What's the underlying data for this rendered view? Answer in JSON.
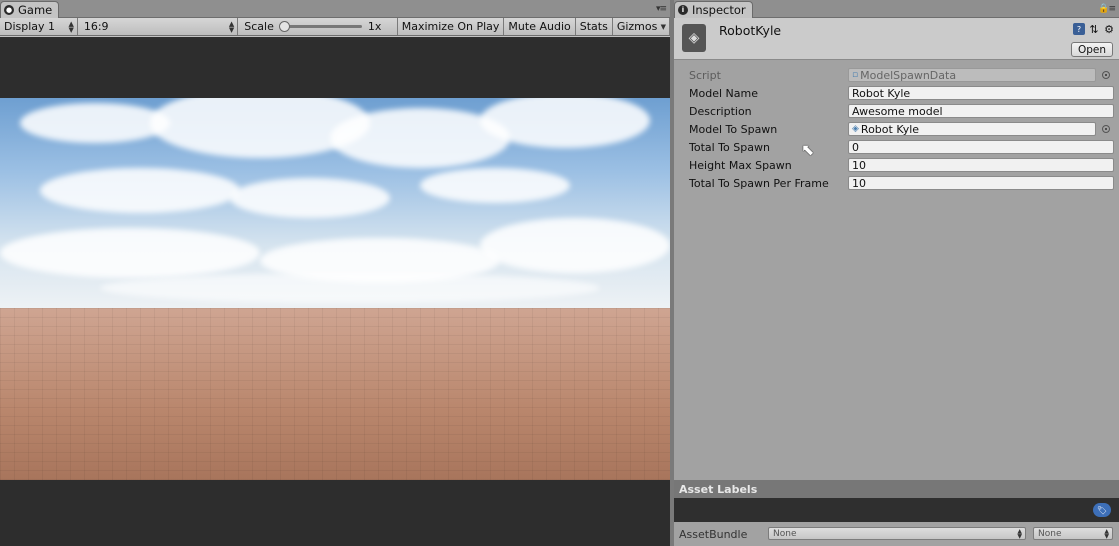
{
  "game": {
    "tab_label": "Game",
    "toolbar": {
      "display": "Display 1",
      "aspect": "16:9",
      "scale_label": "Scale",
      "scale_value": "1x",
      "maximize_on_play": "Maximize On Play",
      "mute_audio": "Mute Audio",
      "stats": "Stats",
      "gizmos": "Gizmos"
    }
  },
  "inspector": {
    "tab_label": "Inspector",
    "asset_name": "RobotKyle",
    "open_button": "Open",
    "fields": [
      {
        "label": "Script",
        "value": "ModelSpawnData"
      },
      {
        "label": "Model Name",
        "value": "Robot Kyle"
      },
      {
        "label": "Description",
        "value": "Awesome model"
      },
      {
        "label": "Model To Spawn",
        "value": "Robot Kyle"
      },
      {
        "label": "Total To Spawn",
        "value": "0"
      },
      {
        "label": "Height Max Spawn",
        "value": "10"
      },
      {
        "label": "Total To Spawn Per Frame",
        "value": "10"
      }
    ],
    "asset_labels": "Asset Labels",
    "asset_bundle": {
      "label": "AssetBundle",
      "name": "None",
      "variant": "None"
    }
  }
}
